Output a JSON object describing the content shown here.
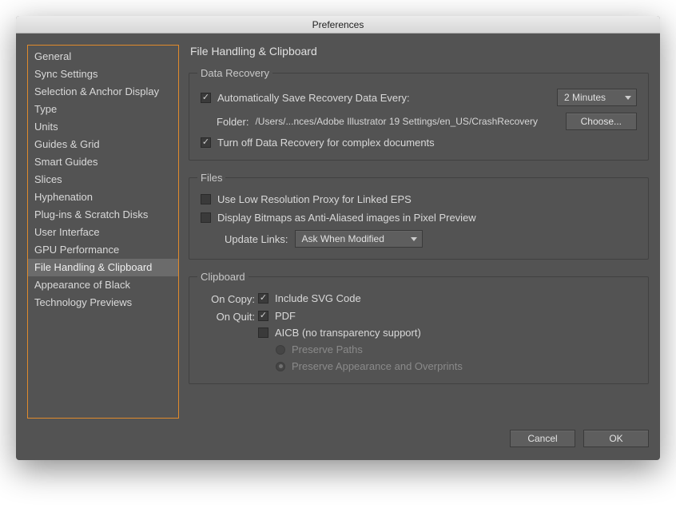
{
  "window": {
    "title": "Preferences"
  },
  "sidebar": {
    "items": [
      {
        "label": "General"
      },
      {
        "label": "Sync Settings"
      },
      {
        "label": "Selection & Anchor Display"
      },
      {
        "label": "Type"
      },
      {
        "label": "Units"
      },
      {
        "label": "Guides & Grid"
      },
      {
        "label": "Smart Guides"
      },
      {
        "label": "Slices"
      },
      {
        "label": "Hyphenation"
      },
      {
        "label": "Plug-ins & Scratch Disks"
      },
      {
        "label": "User Interface"
      },
      {
        "label": "GPU Performance"
      },
      {
        "label": "File Handling & Clipboard",
        "selected": true
      },
      {
        "label": "Appearance of Black"
      },
      {
        "label": "Technology Previews"
      }
    ]
  },
  "main": {
    "title": "File Handling & Clipboard",
    "dataRecovery": {
      "legend": "Data Recovery",
      "autoSave": {
        "checked": true,
        "label": "Automatically Save Recovery Data Every:"
      },
      "interval": "2 Minutes",
      "folderLabel": "Folder:",
      "folderPath": "/Users/...nces/Adobe Illustrator 19 Settings/en_US/CrashRecovery",
      "chooseLabel": "Choose...",
      "turnOff": {
        "checked": true,
        "label": "Turn off Data Recovery for complex documents"
      }
    },
    "files": {
      "legend": "Files",
      "lowRes": {
        "checked": false,
        "label": "Use Low Resolution Proxy for Linked EPS"
      },
      "bitmaps": {
        "checked": false,
        "label": "Display Bitmaps as Anti-Aliased images in Pixel Preview"
      },
      "updateLinksLabel": "Update Links:",
      "updateLinksValue": "Ask When Modified"
    },
    "clipboard": {
      "legend": "Clipboard",
      "onCopyLabel": "On Copy:",
      "includeSvg": {
        "checked": true,
        "label": "Include SVG Code"
      },
      "onQuitLabel": "On Quit:",
      "pdf": {
        "checked": true,
        "label": "PDF"
      },
      "aicb": {
        "checked": false,
        "label": "AICB (no transparency support)"
      },
      "preservePaths": {
        "checked": false,
        "label": "Preserve Paths"
      },
      "preserveAppearance": {
        "checked": true,
        "label": "Preserve Appearance and Overprints"
      }
    }
  },
  "buttons": {
    "cancel": "Cancel",
    "ok": "OK"
  }
}
